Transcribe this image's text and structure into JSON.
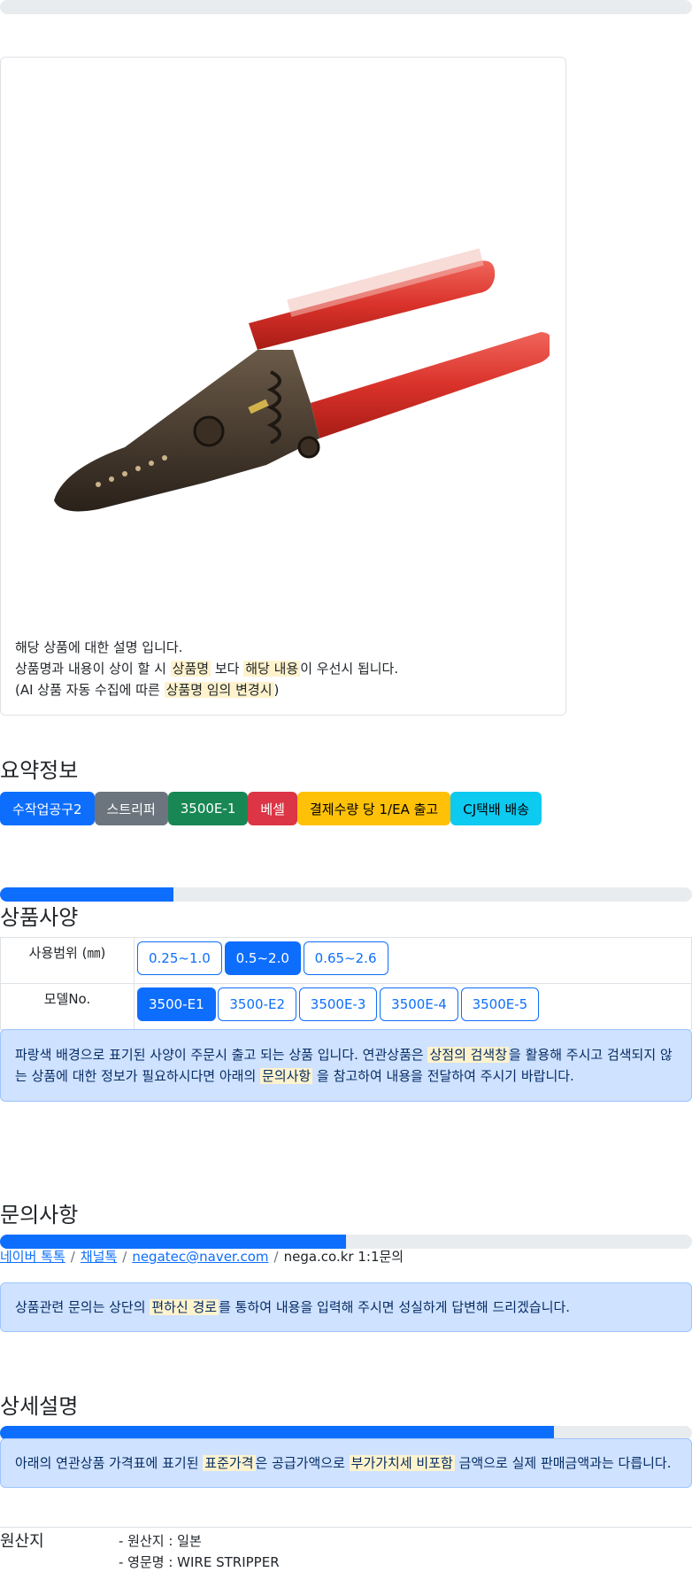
{
  "description": {
    "line1": "해당 상품에 대한 설명 입니다.",
    "line2_a": "상품명과 내용이 상이 할 시",
    "line2_hl1": "상품명",
    "line2_b": "보다",
    "line2_hl2": "해당 내용",
    "line2_c": "이 우선시 됩니다.",
    "line3_a": "(AI 상품 자동 수집에 따른",
    "line3_hl": "상품명 임의 변경시",
    "line3_b": ")"
  },
  "product_image": {
    "icon": "wire-stripper-image"
  },
  "summary": {
    "title": "요약정보",
    "badges": [
      {
        "label": "수작업공구2",
        "color": "#0d6efd",
        "text": "#ffffff"
      },
      {
        "label": "스트리퍼",
        "color": "#6c757d",
        "text": "#ffffff"
      },
      {
        "label": "3500E-1",
        "color": "#198754",
        "text": "#ffffff"
      },
      {
        "label": "베셀",
        "color": "#dc3545",
        "text": "#ffffff"
      },
      {
        "label": "결제수량 당 1/EA 출고",
        "color": "#ffc107",
        "text": "#000000"
      },
      {
        "label": "CJ택배 배송",
        "color": "#0dcaf0",
        "text": "#000000"
      }
    ]
  },
  "specs": {
    "title": "상품사양",
    "progress_fraction": 0.25,
    "rows": [
      {
        "label": "사용범위 (㎜)",
        "options": [
          "0.25~1.0",
          "0.5~2.0",
          "0.65~2.6"
        ],
        "selected": 1
      },
      {
        "label": "모델No.",
        "options": [
          "3500-E1",
          "3500-E2",
          "3500E-3",
          "3500E-4",
          "3500E-5"
        ],
        "selected": 0
      }
    ],
    "notice_a": "파랑색 배경으로 표기된 사양이 주문시 출고 되는 상품 입니다. 연관상품은",
    "notice_hl1": "상점의 검색창",
    "notice_b": "을 활용해 주시고 검색되지 않는 상품에 대한 정보가 필요하시다면 아래의",
    "notice_hl2": "문의사항",
    "notice_c": "을 참고하여 내용을 전달하여 주시기 바랍니다."
  },
  "inquiry": {
    "title": "문의사항",
    "progress_fraction": 0.5,
    "links": [
      "네이버 톡톡",
      "채널톡",
      "negatec@naver.com"
    ],
    "plain": "nega.co.kr 1:1문의",
    "separator": "/",
    "notice_a": "상품관련 문의는 상단의",
    "notice_hl": "편하신 경로",
    "notice_b": "를 통하여 내용을 입력해 주시면 성실하게 답변해 드리겠습니다."
  },
  "details": {
    "title": "상세설명",
    "progress_fraction": 0.8,
    "notice_a": "아래의 연관상품 가격표에 표기된",
    "notice_hl1": "표준가격",
    "notice_b": "은 공급가액으로",
    "notice_hl2": "부가가치세 비포함",
    "notice_c": "금액으로 실제 판매금액과는 다릅니다."
  },
  "origin": {
    "label": "원산지",
    "items": [
      "- 원산지 : 일본",
      "- 영문명 : WIRE STRIPPER"
    ]
  }
}
